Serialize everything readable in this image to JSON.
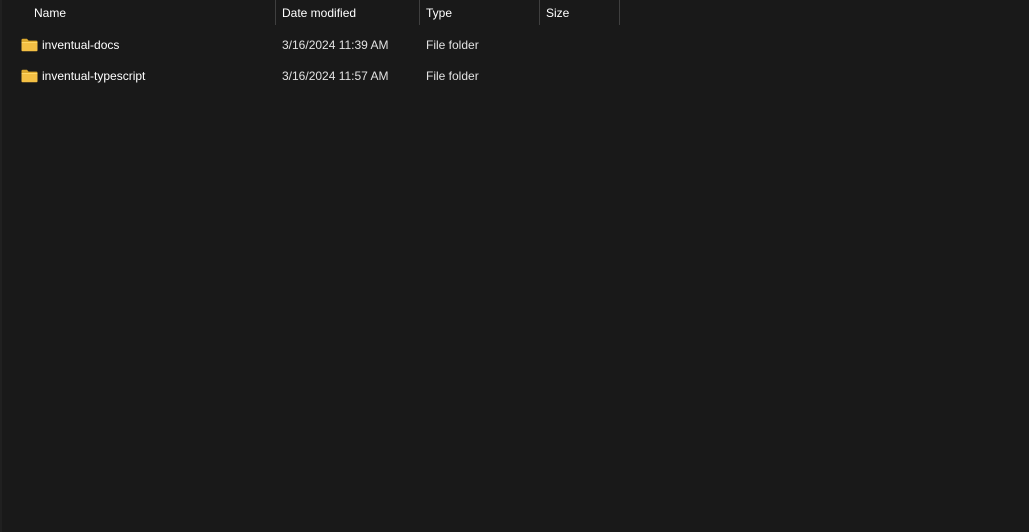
{
  "header": {
    "columns": [
      {
        "label": "Name"
      },
      {
        "label": "Date modified"
      },
      {
        "label": "Type"
      },
      {
        "label": "Size"
      }
    ],
    "sort_indicator": "^"
  },
  "files": [
    {
      "name": "inventual-docs",
      "date_modified": "3/16/2024 11:39 AM",
      "type": "File folder",
      "size": "",
      "icon": "folder-icon"
    },
    {
      "name": "inventual-typescript",
      "date_modified": "3/16/2024 11:57 AM",
      "type": "File folder",
      "size": "",
      "icon": "folder-icon"
    }
  ],
  "colors": {
    "background": "#191919",
    "text": "#ffffff",
    "separator": "#3f3f3f",
    "folder": "#f4c044"
  }
}
